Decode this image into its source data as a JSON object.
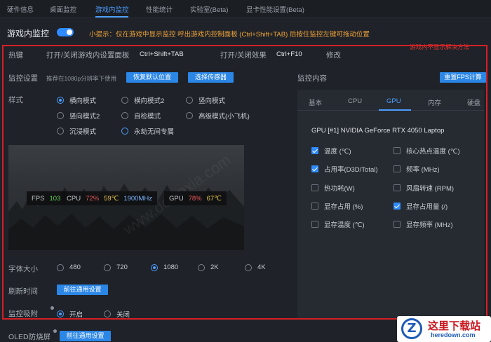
{
  "nav": {
    "tabs": [
      {
        "label": "硬件信息"
      },
      {
        "label": "桌面监控"
      },
      {
        "label": "游戏内监控"
      },
      {
        "label": "性能统计"
      },
      {
        "label": "实验室(Beta)"
      },
      {
        "label": "显卡性能设置(Beta)"
      }
    ],
    "active_index": 2
  },
  "header": {
    "title": "游戏内监控",
    "toggle_on": true,
    "tip": "小提示：仅在游戏中显示监控 呼出游戏内控制面板 (Ctrl+Shift+TAB) 后按住监控左键可拖动位置",
    "annotation": "游戏内不显示解决方法"
  },
  "hotkeys": {
    "title": "热键",
    "panel_label": "打开/关闭游戏内设置面板",
    "panel_key": "Ctrl+Shift+TAB",
    "effect_label": "打开/关闭效果",
    "effect_key": "Ctrl+F10",
    "modify": "修改"
  },
  "monitor_settings": {
    "title": "监控设置",
    "hint": "推荐在1080p分辨率下使用",
    "reset_button": "恢复默认位置",
    "sensor_button": "选择传感器"
  },
  "style": {
    "label": "样式",
    "options": [
      {
        "label": "横向模式",
        "selected": true
      },
      {
        "label": "横向模式2",
        "selected": false
      },
      {
        "label": "竖向模式",
        "selected": false
      },
      {
        "label": "竖向模式2",
        "selected": false
      },
      {
        "label": "自检模式",
        "selected": false
      },
      {
        "label": "高级模式(小飞机)",
        "selected": false
      },
      {
        "label": "沉浸模式",
        "selected": false
      },
      {
        "label": "永劫无间专属",
        "selected": false
      }
    ]
  },
  "preview": {
    "fps_label": "FPS",
    "fps_value": "103",
    "cpu_label": "CPU",
    "cpu_load": "72%",
    "cpu_temp": "59℃",
    "cpu_clock": "1900MHz",
    "gpu_label": "GPU",
    "gpu_load": "78%",
    "gpu_temp": "67℃",
    "watermark": "www.downxia.com"
  },
  "font_size": {
    "label": "字体大小",
    "options": [
      {
        "label": "480",
        "selected": false
      },
      {
        "label": "720",
        "selected": false
      },
      {
        "label": "1080",
        "selected": true
      },
      {
        "label": "2K",
        "selected": false
      },
      {
        "label": "4K",
        "selected": false
      }
    ]
  },
  "refresh": {
    "label": "刷新时间",
    "button": "前往通用设置"
  },
  "snap": {
    "label": "监控吸附",
    "on": "开启",
    "off": "关闭",
    "selected": "开启"
  },
  "oled": {
    "label": "OLED防烧屏",
    "button": "前往通用设置"
  },
  "monitor_content": {
    "title": "监控内容",
    "reset_fps_button": "重置FPS计算",
    "tabs": [
      {
        "label": "基本"
      },
      {
        "label": "CPU"
      },
      {
        "label": "GPU"
      },
      {
        "label": "内存"
      },
      {
        "label": "硬盘"
      }
    ],
    "active_tab": 2,
    "device": "GPU [#1] NVIDIA GeForce RTX 4050 Laptop",
    "items": [
      {
        "label": "温度 (℃)",
        "checked": true
      },
      {
        "label": "核心热点温度 (℃)",
        "checked": false
      },
      {
        "label": "占用率(D3D/Total)",
        "checked": true
      },
      {
        "label": "频率 (MHz)",
        "checked": false
      },
      {
        "label": "热功耗(W)",
        "checked": false
      },
      {
        "label": "风扇转速 (RPM)",
        "checked": false
      },
      {
        "label": "显存占用 (%)",
        "checked": false
      },
      {
        "label": "显存占用量 (/)",
        "checked": true
      },
      {
        "label": "显存温度 (℃)",
        "checked": false
      },
      {
        "label": "显存频率 (MHz)",
        "checked": false
      }
    ]
  },
  "logo": {
    "text": "这里下载站",
    "site": "heredown.com",
    "mark": "Z"
  },
  "colors": {
    "accent": "#4c9eff",
    "button": "#2b86e6",
    "frame": "#d51f26",
    "tip": "#f0a43a"
  }
}
